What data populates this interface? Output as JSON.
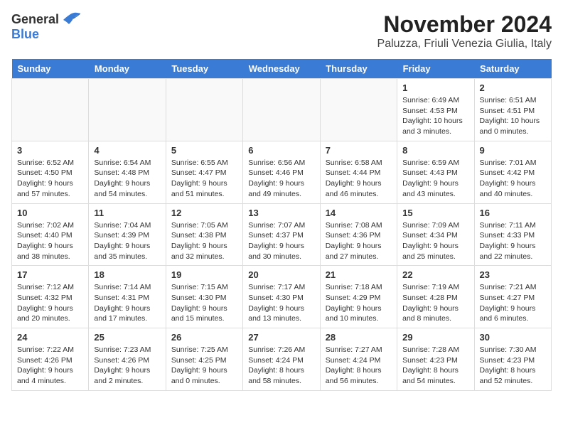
{
  "logo": {
    "general": "General",
    "blue": "Blue"
  },
  "title": "November 2024",
  "subtitle": "Paluzza, Friuli Venezia Giulia, Italy",
  "days_header": [
    "Sunday",
    "Monday",
    "Tuesday",
    "Wednesday",
    "Thursday",
    "Friday",
    "Saturday"
  ],
  "weeks": [
    [
      {
        "day": "",
        "info": ""
      },
      {
        "day": "",
        "info": ""
      },
      {
        "day": "",
        "info": ""
      },
      {
        "day": "",
        "info": ""
      },
      {
        "day": "",
        "info": ""
      },
      {
        "day": "1",
        "info": "Sunrise: 6:49 AM\nSunset: 4:53 PM\nDaylight: 10 hours\nand 3 minutes."
      },
      {
        "day": "2",
        "info": "Sunrise: 6:51 AM\nSunset: 4:51 PM\nDaylight: 10 hours\nand 0 minutes."
      }
    ],
    [
      {
        "day": "3",
        "info": "Sunrise: 6:52 AM\nSunset: 4:50 PM\nDaylight: 9 hours\nand 57 minutes."
      },
      {
        "day": "4",
        "info": "Sunrise: 6:54 AM\nSunset: 4:48 PM\nDaylight: 9 hours\nand 54 minutes."
      },
      {
        "day": "5",
        "info": "Sunrise: 6:55 AM\nSunset: 4:47 PM\nDaylight: 9 hours\nand 51 minutes."
      },
      {
        "day": "6",
        "info": "Sunrise: 6:56 AM\nSunset: 4:46 PM\nDaylight: 9 hours\nand 49 minutes."
      },
      {
        "day": "7",
        "info": "Sunrise: 6:58 AM\nSunset: 4:44 PM\nDaylight: 9 hours\nand 46 minutes."
      },
      {
        "day": "8",
        "info": "Sunrise: 6:59 AM\nSunset: 4:43 PM\nDaylight: 9 hours\nand 43 minutes."
      },
      {
        "day": "9",
        "info": "Sunrise: 7:01 AM\nSunset: 4:42 PM\nDaylight: 9 hours\nand 40 minutes."
      }
    ],
    [
      {
        "day": "10",
        "info": "Sunrise: 7:02 AM\nSunset: 4:40 PM\nDaylight: 9 hours\nand 38 minutes."
      },
      {
        "day": "11",
        "info": "Sunrise: 7:04 AM\nSunset: 4:39 PM\nDaylight: 9 hours\nand 35 minutes."
      },
      {
        "day": "12",
        "info": "Sunrise: 7:05 AM\nSunset: 4:38 PM\nDaylight: 9 hours\nand 32 minutes."
      },
      {
        "day": "13",
        "info": "Sunrise: 7:07 AM\nSunset: 4:37 PM\nDaylight: 9 hours\nand 30 minutes."
      },
      {
        "day": "14",
        "info": "Sunrise: 7:08 AM\nSunset: 4:36 PM\nDaylight: 9 hours\nand 27 minutes."
      },
      {
        "day": "15",
        "info": "Sunrise: 7:09 AM\nSunset: 4:34 PM\nDaylight: 9 hours\nand 25 minutes."
      },
      {
        "day": "16",
        "info": "Sunrise: 7:11 AM\nSunset: 4:33 PM\nDaylight: 9 hours\nand 22 minutes."
      }
    ],
    [
      {
        "day": "17",
        "info": "Sunrise: 7:12 AM\nSunset: 4:32 PM\nDaylight: 9 hours\nand 20 minutes."
      },
      {
        "day": "18",
        "info": "Sunrise: 7:14 AM\nSunset: 4:31 PM\nDaylight: 9 hours\nand 17 minutes."
      },
      {
        "day": "19",
        "info": "Sunrise: 7:15 AM\nSunset: 4:30 PM\nDaylight: 9 hours\nand 15 minutes."
      },
      {
        "day": "20",
        "info": "Sunrise: 7:17 AM\nSunset: 4:30 PM\nDaylight: 9 hours\nand 13 minutes."
      },
      {
        "day": "21",
        "info": "Sunrise: 7:18 AM\nSunset: 4:29 PM\nDaylight: 9 hours\nand 10 minutes."
      },
      {
        "day": "22",
        "info": "Sunrise: 7:19 AM\nSunset: 4:28 PM\nDaylight: 9 hours\nand 8 minutes."
      },
      {
        "day": "23",
        "info": "Sunrise: 7:21 AM\nSunset: 4:27 PM\nDaylight: 9 hours\nand 6 minutes."
      }
    ],
    [
      {
        "day": "24",
        "info": "Sunrise: 7:22 AM\nSunset: 4:26 PM\nDaylight: 9 hours\nand 4 minutes."
      },
      {
        "day": "25",
        "info": "Sunrise: 7:23 AM\nSunset: 4:26 PM\nDaylight: 9 hours\nand 2 minutes."
      },
      {
        "day": "26",
        "info": "Sunrise: 7:25 AM\nSunset: 4:25 PM\nDaylight: 9 hours\nand 0 minutes."
      },
      {
        "day": "27",
        "info": "Sunrise: 7:26 AM\nSunset: 4:24 PM\nDaylight: 8 hours\nand 58 minutes."
      },
      {
        "day": "28",
        "info": "Sunrise: 7:27 AM\nSunset: 4:24 PM\nDaylight: 8 hours\nand 56 minutes."
      },
      {
        "day": "29",
        "info": "Sunrise: 7:28 AM\nSunset: 4:23 PM\nDaylight: 8 hours\nand 54 minutes."
      },
      {
        "day": "30",
        "info": "Sunrise: 7:30 AM\nSunset: 4:23 PM\nDaylight: 8 hours\nand 52 minutes."
      }
    ]
  ]
}
